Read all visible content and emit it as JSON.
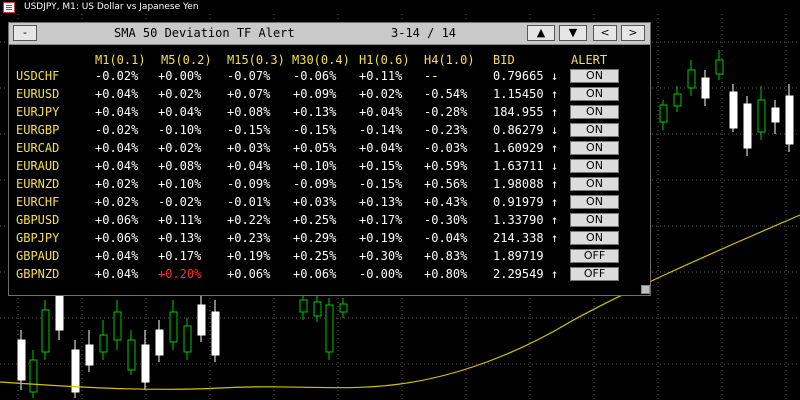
{
  "window": {
    "title": "USDJPY, M1:  US Dollar vs Japanese Yen"
  },
  "panel": {
    "minimize_label": "-",
    "title": "SMA 50 Deviation  TF Alert",
    "range": "3-14 / 14",
    "nav": {
      "up": "▲",
      "down": "▼",
      "prev": "<",
      "next": ">"
    }
  },
  "columns": [
    "M1(0.1)",
    "M5(0.2)",
    "M15(0.3)",
    "M30(0.4)",
    "H1(0.6)",
    "H4(1.0)",
    "BID",
    "ALERT"
  ],
  "rows": [
    {
      "symbol": "USDCHF",
      "m1": "-0.02%",
      "m5": "+0.00%",
      "m15": "-0.07%",
      "m30": "-0.06%",
      "h1": "+0.11%",
      "h4": "--",
      "bid": "0.79665",
      "arrow": "↓",
      "alert": "ON"
    },
    {
      "symbol": "EURUSD",
      "m1": "+0.04%",
      "m5": "+0.02%",
      "m15": "+0.07%",
      "m30": "+0.09%",
      "h1": "+0.02%",
      "h4": "-0.54%",
      "bid": "1.15450",
      "arrow": "↑",
      "alert": "ON"
    },
    {
      "symbol": "EURJPY",
      "m1": "+0.04%",
      "m5": "+0.04%",
      "m15": "+0.08%",
      "m30": "+0.13%",
      "h1": "+0.04%",
      "h4": "-0.28%",
      "bid": "184.955",
      "arrow": "↑",
      "alert": "ON"
    },
    {
      "symbol": "EURGBP",
      "m1": "-0.02%",
      "m5": "-0.10%",
      "m15": "-0.15%",
      "m30": "-0.15%",
      "h1": "-0.14%",
      "h4": "-0.23%",
      "bid": "0.86279",
      "arrow": "↓",
      "alert": "ON"
    },
    {
      "symbol": "EURCAD",
      "m1": "+0.04%",
      "m5": "+0.02%",
      "m15": "+0.03%",
      "m30": "+0.05%",
      "h1": "+0.04%",
      "h4": "-0.03%",
      "bid": "1.60929",
      "arrow": "↑",
      "alert": "ON"
    },
    {
      "symbol": "EURAUD",
      "m1": "+0.04%",
      "m5": "+0.08%",
      "m15": "+0.04%",
      "m30": "+0.10%",
      "h1": "+0.15%",
      "h4": "+0.59%",
      "bid": "1.63711",
      "arrow": "↓",
      "alert": "ON"
    },
    {
      "symbol": "EURNZD",
      "m1": "+0.02%",
      "m5": "+0.10%",
      "m15": "-0.09%",
      "m30": "-0.09%",
      "h1": "-0.15%",
      "h4": "+0.56%",
      "bid": "1.98088",
      "arrow": "↑",
      "alert": "ON"
    },
    {
      "symbol": "EURCHF",
      "m1": "+0.02%",
      "m5": "-0.02%",
      "m15": "-0.01%",
      "m30": "+0.03%",
      "h1": "+0.13%",
      "h4": "+0.43%",
      "bid": "0.91979",
      "arrow": "↑",
      "alert": "ON"
    },
    {
      "symbol": "GBPUSD",
      "m1": "+0.06%",
      "m5": "+0.11%",
      "m15": "+0.22%",
      "m30": "+0.25%",
      "h1": "+0.17%",
      "h4": "-0.30%",
      "bid": "1.33790",
      "arrow": "↑",
      "alert": "ON"
    },
    {
      "symbol": "GBPJPY",
      "m1": "+0.06%",
      "m5": "+0.13%",
      "m15": "+0.23%",
      "m30": "+0.29%",
      "h1": "+0.19%",
      "h4": "-0.04%",
      "bid": "214.338",
      "arrow": "↑",
      "alert": "ON"
    },
    {
      "symbol": "GBPAUD",
      "m1": "+0.04%",
      "m5": "+0.17%",
      "m15": "+0.19%",
      "m30": "+0.25%",
      "h1": "+0.30%",
      "h4": "+0.83%",
      "bid": "1.89719",
      "arrow": "",
      "alert": "OFF"
    },
    {
      "symbol": "GBPNZD",
      "m1": "+0.04%",
      "m5": "+0.20%",
      "m15": "+0.06%",
      "m30": "+0.06%",
      "h1": "-0.00%",
      "h4": "+0.80%",
      "bid": "2.29549",
      "arrow": "↑",
      "alert": "OFF",
      "highlight_m5": true
    }
  ],
  "colors": {
    "chart_bg": "#000000",
    "symbol_text": "#f2e04a",
    "header_text": "#f2e04a",
    "value_text": "#ffffff",
    "alert_highlight": "#ff2a2a",
    "candle_up": "#00c800",
    "candle_down": "#ffffff",
    "ma_line": "#d4c200"
  }
}
